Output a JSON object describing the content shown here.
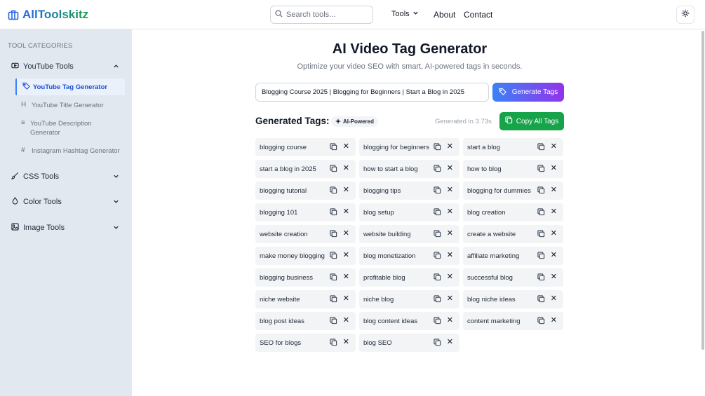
{
  "header": {
    "logo_text": "AllToolskitz",
    "search_placeholder": "Search tools...",
    "nav": {
      "tools": "Tools",
      "about": "About",
      "contact": "Contact"
    }
  },
  "sidebar": {
    "heading": "TOOL CATEGORIES",
    "categories": [
      {
        "label": "YouTube Tools",
        "expanded": true
      },
      {
        "label": "CSS Tools",
        "expanded": false
      },
      {
        "label": "Color Tools",
        "expanded": false
      },
      {
        "label": "Image Tools",
        "expanded": false
      }
    ],
    "youtube_items": [
      {
        "label": "YouTube Tag Generator",
        "active": true
      },
      {
        "label": "YouTube Title Generator"
      },
      {
        "label": "YouTube Description Generator"
      },
      {
        "label": "Instagram Hashtag Generator"
      }
    ]
  },
  "main": {
    "title": "AI Video Tag Generator",
    "subtitle": "Optimize your video SEO with smart, AI-powered tags in seconds.",
    "input_value": "Blogging Course 2025 | Blogging for Beginners | Start a Blog in 2025",
    "generate_label": "Generate Tags",
    "generated_label": "Generated Tags:",
    "ai_badge": "AI-Powered",
    "generated_time": "Generated in 3.73s",
    "copy_all_label": "Copy All Tags",
    "tags": [
      "blogging course",
      "blogging for beginners",
      "start a blog",
      "start a blog in 2025",
      "how to start a blog",
      "how to blog",
      "blogging tutorial",
      "blogging tips",
      "blogging for dummies",
      "blogging 101",
      "blog setup",
      "blog creation",
      "website creation",
      "website building",
      "create a website",
      "make money blogging",
      "blog monetization",
      "affiliate marketing",
      "blogging business",
      "profitable blog",
      "successful blog",
      "niche website",
      "niche blog",
      "blog niche ideas",
      "blog post ideas",
      "blog content ideas",
      "content marketing",
      "SEO for blogs",
      "blog SEO"
    ]
  },
  "colors": {
    "accent_blue": "#3b82f6",
    "accent_purple": "#9333ea",
    "copy_green": "#16a34a",
    "sidebar_bg": "#e2e8f0"
  }
}
